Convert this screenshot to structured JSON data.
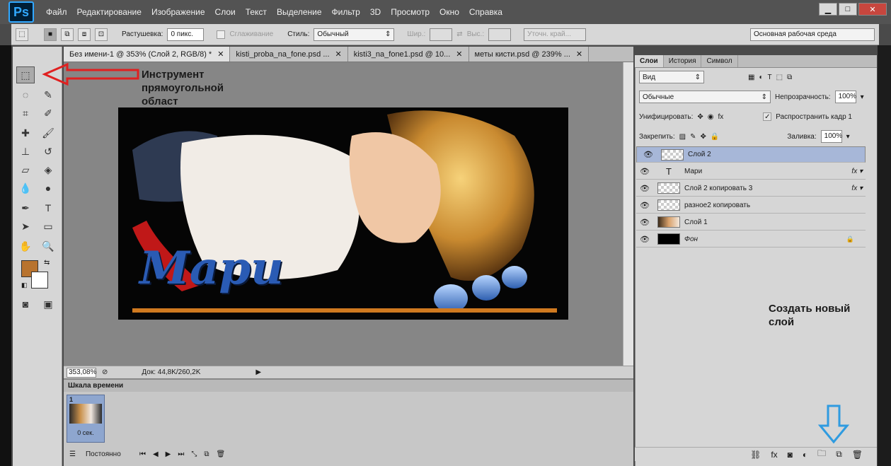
{
  "app": {
    "logo": "Ps"
  },
  "menu": [
    "Файл",
    "Редактирование",
    "Изображение",
    "Слои",
    "Текст",
    "Выделение",
    "Фильтр",
    "3D",
    "Просмотр",
    "Окно",
    "Справка"
  ],
  "window_buttons": {
    "minimize": "▁",
    "maximize": "□",
    "close": "✕"
  },
  "options": {
    "feather_label": "Растушевка:",
    "feather_value": "0 пикс.",
    "antialias_label": "Сглаживание",
    "style_label": "Стиль:",
    "style_value": "Обычный",
    "width_label": "Шир.:",
    "height_label": "Выс.:",
    "refine_edge": "Уточн. край...",
    "workspace": "Основная рабочая среда"
  },
  "tabs": [
    {
      "label": "Без имени-1 @ 353% (Слой 2, RGB/8) *"
    },
    {
      "label": "kisti_proba_na_fone.psd ..."
    },
    {
      "label": "kisti3_na_fone1.psd @ 10..."
    },
    {
      "label": "меты кисти.psd @ 239% ..."
    }
  ],
  "status": {
    "zoom": "353,08%",
    "doc": "Док: 44,8K/260,2K"
  },
  "timeline": {
    "title": "Шкала времени",
    "frame_number": "1",
    "frame_delay": "0 сек.",
    "loop": "Постоянно"
  },
  "panel": {
    "tabs": [
      "Слои",
      "История",
      "Символ"
    ],
    "filter_kind": "Вид",
    "blend_mode": "Обычные",
    "opacity_label": "Непрозрачность:",
    "opacity_value": "100%",
    "unify_label": "Унифицировать:",
    "propagate_label": "Распространить кадр 1",
    "lock_label": "Закрепить:",
    "fill_label": "Заливка:",
    "fill_value": "100%"
  },
  "layers": [
    {
      "name": "Слой 2",
      "selected": true,
      "fx": false,
      "type": "empty"
    },
    {
      "name": "Мари",
      "selected": false,
      "fx": true,
      "type": "text"
    },
    {
      "name": "Слой 2 копировать 3",
      "selected": false,
      "fx": true,
      "type": "empty"
    },
    {
      "name": "разное2 копировать",
      "selected": false,
      "fx": false,
      "type": "empty"
    },
    {
      "name": "Слой 1",
      "selected": false,
      "fx": false,
      "type": "image"
    },
    {
      "name": "Фон",
      "selected": false,
      "fx": false,
      "type": "black"
    }
  ],
  "annotations": {
    "tool_note": "Инструмент прямоугольной област",
    "new_layer_note": "Создать новый слой"
  },
  "canvas_text": "Мари",
  "colors": {
    "foreground": "#b8732e",
    "background": "#ffffff",
    "annotation_arrow": "#e02020",
    "new_layer_arrow": "#2f9be0"
  }
}
